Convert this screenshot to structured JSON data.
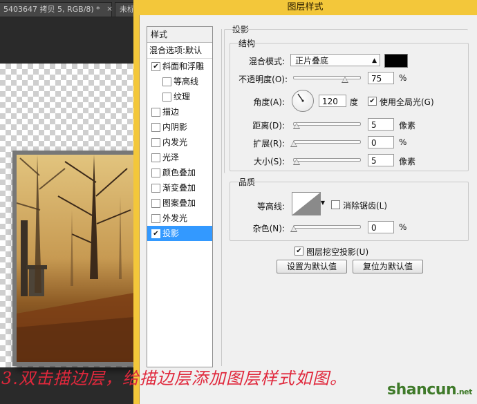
{
  "ps": {
    "tab_doc": "5403647 拷贝 5, RGB/8) *",
    "tab_close": "×",
    "tab_other": "未标"
  },
  "dialog": {
    "title": "图层样式"
  },
  "style_list": {
    "header": "样式",
    "blend_default": "混合选项:默认",
    "items": [
      {
        "label": "斜面和浮雕",
        "checked": true
      },
      {
        "label": "等高线",
        "checked": false
      },
      {
        "label": "纹理",
        "checked": false
      },
      {
        "label": "描边",
        "checked": false
      },
      {
        "label": "内阴影",
        "checked": false
      },
      {
        "label": "内发光",
        "checked": false
      },
      {
        "label": "光泽",
        "checked": false
      },
      {
        "label": "颜色叠加",
        "checked": false
      },
      {
        "label": "渐变叠加",
        "checked": false
      },
      {
        "label": "图案叠加",
        "checked": false
      },
      {
        "label": "外发光",
        "checked": false
      },
      {
        "label": "投影",
        "checked": true
      }
    ],
    "selected": "投影"
  },
  "drop_shadow": {
    "section_title": "投影",
    "structure_title": "结构",
    "blend_mode_label": "混合模式:",
    "blend_mode_value": "正片叠底",
    "shadow_color": "#000000",
    "opacity_label": "不透明度(O):",
    "opacity_value": "75",
    "opacity_unit": "%",
    "angle_label": "角度(A):",
    "angle_value": "120",
    "angle_unit": "度",
    "global_light_label": "使用全局光(G)",
    "global_light_checked": true,
    "distance_label": "距离(D):",
    "distance_value": "5",
    "distance_unit": "像素",
    "spread_label": "扩展(R):",
    "spread_value": "0",
    "spread_unit": "%",
    "size_label": "大小(S):",
    "size_value": "5",
    "size_unit": "像素",
    "quality_title": "品质",
    "contour_label": "等高线:",
    "antialias_label": "消除锯齿(L)",
    "antialias_checked": false,
    "noise_label": "杂色(N):",
    "noise_value": "0",
    "noise_unit": "%",
    "knockout_label": "图层挖空投影(U)",
    "knockout_checked": true,
    "make_default": "设置为默认值",
    "reset_default": "复位为默认值"
  },
  "caption": "3.双击描边层，给描边层添加图层样式如图。",
  "watermark": {
    "text": "shancun",
    "tld": ".net"
  }
}
